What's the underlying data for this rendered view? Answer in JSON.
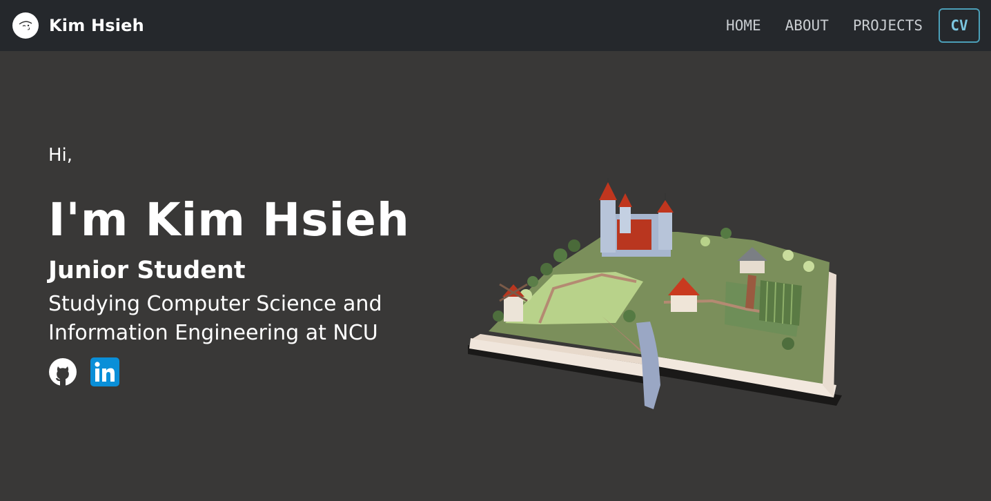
{
  "brand": {
    "name": "Kim Hsieh",
    "avatar_icon": "avatar-icon"
  },
  "nav": {
    "items": [
      "HOME",
      "ABOUT",
      "PROJECTS"
    ],
    "cv_label": "CV"
  },
  "hero": {
    "greeting": "Hi,",
    "title": "I'm Kim Hsieh",
    "subtitle": "Junior Student",
    "description": "Studying Computer Science and Information Engineering at NCU"
  },
  "social": {
    "github_icon": "github-icon",
    "linkedin_icon": "linkedin-icon"
  },
  "colors": {
    "background": "#393837",
    "navbar": "#25282c",
    "nav_text": "#c9cdd1",
    "cv_accent": "#4b9fb8",
    "linkedin_blue": "#0a8fd8"
  }
}
